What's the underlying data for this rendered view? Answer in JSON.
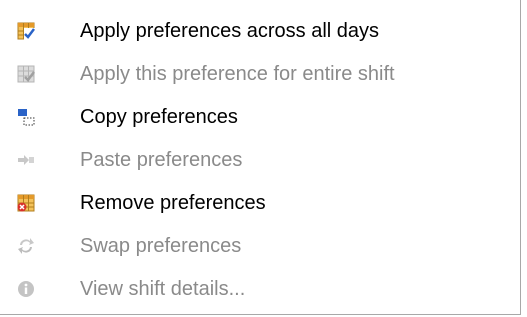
{
  "context_menu": {
    "items": [
      {
        "label": "Apply preferences across all days",
        "icon": "grid-check-icon",
        "enabled": true
      },
      {
        "label": "Apply this preference for entire shift",
        "icon": "grid-check-icon",
        "enabled": false
      },
      {
        "label": "Copy preferences",
        "icon": "copy-icon",
        "enabled": true
      },
      {
        "label": "Paste preferences",
        "icon": "paste-arrow-icon",
        "enabled": false
      },
      {
        "label": "Remove preferences",
        "icon": "grid-remove-icon",
        "enabled": true
      },
      {
        "label": "Swap preferences",
        "icon": "swap-icon",
        "enabled": false
      },
      {
        "label": "View shift details...",
        "icon": "info-icon",
        "enabled": false
      }
    ]
  },
  "colors": {
    "enabled_text": "#000000",
    "disabled_text": "#8a8a8a",
    "accent_blue": "#2a63c7",
    "remove_red": "#d9322b"
  }
}
